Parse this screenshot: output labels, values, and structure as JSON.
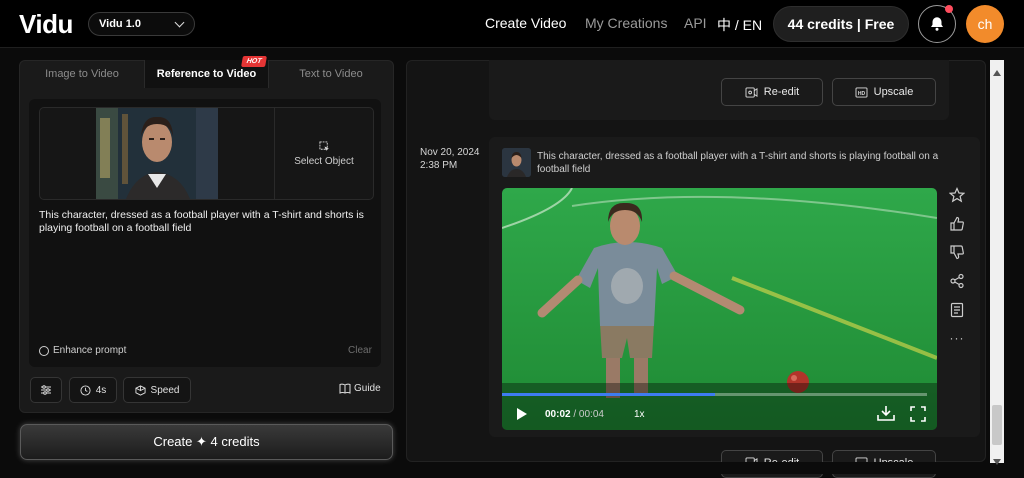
{
  "header": {
    "logo": "Vidu",
    "model_select": "Vidu 1.0",
    "nav": [
      "Create Video",
      "My Creations",
      "API"
    ],
    "lang": "中 / EN",
    "credits": "44 credits | Free",
    "avatar_initials": "ch",
    "accent_color": "#f28b2b"
  },
  "left": {
    "tabs": [
      "Image to Video",
      "Reference to Video",
      "Text to Video"
    ],
    "active_tab": "Reference to Video",
    "hot_badge": "HOT",
    "select_object": "Select Object",
    "prompt": "This character, dressed as a football player with a T-shirt and shorts is playing football on a football field",
    "enhance_prompt": "Enhance prompt",
    "clear": "Clear",
    "duration": "4s",
    "speed": "Speed",
    "guide": "Guide",
    "create_label": "Create ✦ 4 credits"
  },
  "right": {
    "reedit": "Re-edit",
    "upscale": "Upscale",
    "date": "Nov 20, 2024",
    "time": "2:38 PM",
    "caption": "This character, dressed as a football player with a T-shirt and shorts is playing football on a football field",
    "player": {
      "current": "00:02",
      "separator": " / ",
      "duration": "00:04",
      "speed": "1x",
      "progress": 0.5
    },
    "side_icons": [
      "star-icon",
      "thumbs-up-icon",
      "thumbs-down-icon",
      "share-icon",
      "details-icon",
      "more-icon"
    ]
  }
}
